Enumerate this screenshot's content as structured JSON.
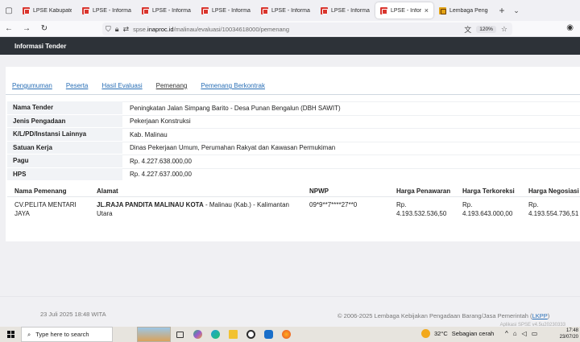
{
  "browser": {
    "tabs": [
      {
        "label": "LPSE Kabupaten",
        "favicon": "lpse",
        "active": false
      },
      {
        "label": "LPSE - Informasi",
        "favicon": "lpse",
        "active": false
      },
      {
        "label": "LPSE - Informasi",
        "favicon": "lpse",
        "active": false
      },
      {
        "label": "LPSE - Informasi",
        "favicon": "lpse",
        "active": false
      },
      {
        "label": "LPSE - Informasi",
        "favicon": "lpse",
        "active": false
      },
      {
        "label": "LPSE - Informasi",
        "favicon": "lpse",
        "active": false
      },
      {
        "label": "LPSE - Informa",
        "favicon": "lpse",
        "active": true
      },
      {
        "label": "Lembaga Pengen",
        "favicon": "lkpp",
        "active": false
      }
    ],
    "url_prefix": "spse.",
    "url_domain": "inaproc.id",
    "url_path": "/malinau/evaluasi/10034618000/pemenang",
    "zoom": "120%"
  },
  "page": {
    "header_title": "Informasi Tender",
    "tabs": [
      {
        "label": "Pengumuman",
        "current": false
      },
      {
        "label": "Peserta",
        "current": false
      },
      {
        "label": "Hasil Evaluasi",
        "current": false
      },
      {
        "label": "Pemenang",
        "current": true
      },
      {
        "label": "Pemenang Berkontrak",
        "current": false
      }
    ],
    "info": [
      {
        "key": "Nama Tender",
        "value": "Peningkatan Jalan Simpang Barito - Desa Punan Bengalun (DBH SAWIT)"
      },
      {
        "key": "Jenis Pengadaan",
        "value": "Pekerjaan Konstruksi"
      },
      {
        "key": "K/L/PD/Instansi Lainnya",
        "value": "Kab. Malinau"
      },
      {
        "key": "Satuan Kerja",
        "value": "Dinas Pekerjaan Umum, Perumahan Rakyat dan Kawasan Permukiman"
      },
      {
        "key": "Pagu",
        "value": "Rp. 4.227.638.000,00"
      },
      {
        "key": "HPS",
        "value": "Rp. 4.227.637.000,00"
      }
    ],
    "winner_table": {
      "headers": {
        "name": "Nama Pemenang",
        "address": "Alamat",
        "npwp": "NPWP",
        "offer": "Harga Penawaran",
        "corrected": "Harga Terkoreksi",
        "negotiated": "Harga Negosiasi"
      },
      "row": {
        "name": "CV.PELITA MENTARI JAYA",
        "address_bold": "JL.RAJA PANDITA MALINAU KOTA",
        "address_rest": " - Malinau (Kab.) - Kalimantan Utara",
        "npwp": "09*9**7****27**0",
        "offer_prefix": "Rp.",
        "offer": "4.193.532.536,50",
        "corrected_prefix": "Rp.",
        "corrected": "4.193.643.000,00",
        "negotiated_prefix": "Rp.",
        "negotiated": "4.193.554.736,51"
      }
    },
    "footer": {
      "date": "23 Juli 2025 18:48 WITA",
      "copyright": "© 2006-2025 Lembaga Kebijakan Pengadaan Barang/Jasa Pemerintah (",
      "lkpp_link": "LKPP",
      "copyright_end": ")",
      "version": "Aplikasi SPSE v4.5u20230333"
    }
  },
  "taskbar": {
    "search_placeholder": "Type here to search",
    "weather_temp": "32°C",
    "weather_desc": "Sebagian cerah",
    "time": "17:48",
    "date": "23/07/20"
  }
}
